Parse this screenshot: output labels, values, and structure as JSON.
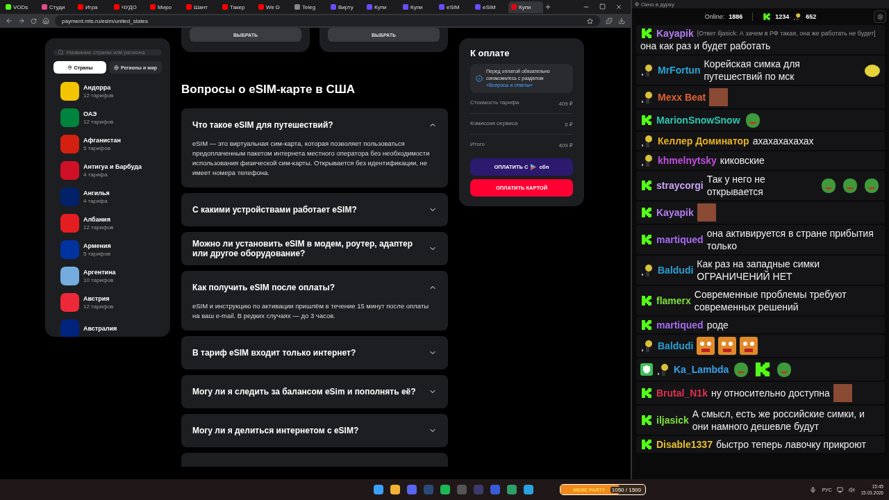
{
  "browser": {
    "tabs": [
      {
        "label": "VODs",
        "kind": "kick",
        "selected": false
      },
      {
        "label": "Студи",
        "kind": "studio",
        "selected": false
      },
      {
        "label": "Игра",
        "kind": "youtube",
        "selected": false
      },
      {
        "label": "ЧУДО",
        "kind": "youtube",
        "selected": false
      },
      {
        "label": "Миро",
        "kind": "youtube",
        "selected": false
      },
      {
        "label": "Шант",
        "kind": "youtube",
        "selected": false
      },
      {
        "label": "Такер",
        "kind": "youtube",
        "selected": false
      },
      {
        "label": "We D",
        "kind": "youtube",
        "selected": false
      },
      {
        "label": "Teleg",
        "kind": "globe",
        "selected": false
      },
      {
        "label": "Вирту",
        "kind": "purple",
        "selected": false
      },
      {
        "label": "Купи",
        "kind": "purple",
        "selected": false
      },
      {
        "label": "Купи",
        "kind": "purple",
        "selected": false
      },
      {
        "label": "eSIM",
        "kind": "purple",
        "selected": false
      },
      {
        "label": "eSIM",
        "kind": "purple",
        "selected": false
      },
      {
        "label": "Купи",
        "kind": "mts",
        "selected": true
      }
    ],
    "url": "payment.mts.ru/esim/united_states"
  },
  "sidebar": {
    "search_placeholder": "Название страны или региона",
    "tabs": [
      {
        "label": "Страны",
        "selected": true
      },
      {
        "label": "Регионы и мир",
        "selected": false
      }
    ],
    "countries": [
      {
        "name": "Андорра",
        "tariffs": "12 тарифов",
        "color": "#f2c500"
      },
      {
        "name": "ОАЭ",
        "tariffs": "12 тарифов",
        "color": "#00843d"
      },
      {
        "name": "Афганистан",
        "tariffs": "5 тарифов",
        "color": "#d32011"
      },
      {
        "name": "Антигуа и Барбуда",
        "tariffs": "4 тарифа",
        "color": "#ce1126"
      },
      {
        "name": "Ангилья",
        "tariffs": "4 тарифа",
        "color": "#012169"
      },
      {
        "name": "Албания",
        "tariffs": "12 тарифов",
        "color": "#e41e20"
      },
      {
        "name": "Армения",
        "tariffs": "5 тарифов",
        "color": "#0033a0"
      },
      {
        "name": "Аргентина",
        "tariffs": "10 тарифов",
        "color": "#74acdf"
      },
      {
        "name": "Австрия",
        "tariffs": "12 тарифов",
        "color": "#ed2939"
      },
      {
        "name": "Австралия",
        "color": "#00247d"
      }
    ]
  },
  "plans": [
    {
      "button": "ВЫБРАТЬ"
    },
    {
      "button": "ВЫБРАТЬ"
    }
  ],
  "faq": {
    "title": "Вопросы о eSIM-карте в США",
    "items": [
      {
        "question": "Что такое eSIM для путешествий?",
        "expanded": true,
        "answer": "eSIM — это виртуальная сим-карта, которая позволяет пользоваться предоплаченным пакетом интернета местного оператора без необходимости использования физической сим-карты. Открывается без идентификации, не имеет номера телефона."
      },
      {
        "question": "С какими устройствами работает eSIM?",
        "expanded": false
      },
      {
        "question": "Можно ли установить eSIM в модем, роутер, адаптер или другое оборудование?",
        "expanded": false
      },
      {
        "question": "Как получить eSIM после оплаты?",
        "expanded": true,
        "answer": "eSIM и инструкцию по активации пришлём в течение 15 минут после оплаты на ваш e-mail. В редких случаях — до 3 часов."
      },
      {
        "question": "В тариф eSIM входит только интернет?",
        "expanded": false
      },
      {
        "question": "Могу ли я следить за балансом eSim и пополнять её?",
        "expanded": false
      },
      {
        "question": "Могу ли я делиться интернетом с eSIM?",
        "expanded": false
      }
    ]
  },
  "payment": {
    "title": "К оплате",
    "notice": "Перед оплатой обязательно ознакомьтесь с разделом",
    "notice_link": "«Вопросы и ответы»",
    "rows": [
      {
        "label": "Стоимость тарифа",
        "value": "409 ₽"
      },
      {
        "label": "Комиссия сервиса",
        "value": "0 ₽"
      },
      {
        "label": "Итого",
        "value": "409 ₽"
      }
    ],
    "sbp_button": "ОПЛАТИТЬ С",
    "sbp_logo": "сбп",
    "card_button": "ОПЛАТИТЬ КАРТОЙ"
  },
  "chat": {
    "window_title": "Окно в дурку",
    "online_label": "Online:",
    "online": "1886",
    "kick_count": "1234",
    "bot_count": "652",
    "messages": [
      {
        "badges": [
          {
            "kind": "kick"
          }
        ],
        "user": "Kayapik",
        "color": "#b57cf0",
        "reply": "[Ответ iljasick: А зачем в РФ такая, она же работать не будет]",
        "text": "она как раз и будет работать"
      },
      {
        "badges": [
          {
            "kind": "bot"
          }
        ],
        "user": "MrFortun",
        "color": "#2aa6d8",
        "text": "Корейская симка для путешествий по мск",
        "emotes": [
          {
            "kind": "yellow"
          }
        ]
      },
      {
        "badges": [
          {
            "kind": "bot"
          }
        ],
        "user": "Mexx Beat",
        "color": "#e0612f",
        "emotes": [
          {
            "kind": "face"
          }
        ]
      },
      {
        "badges": [
          {
            "kind": "kick"
          }
        ],
        "user": "MarionSnowSnow",
        "color": "#2fc7b0",
        "emotes": [
          {
            "kind": "pepe"
          }
        ]
      },
      {
        "badges": [
          {
            "kind": "bot"
          }
        ],
        "user": "Келлер Доминатор",
        "color": "#e8b220",
        "text": "ахахахахахах"
      },
      {
        "badges": [
          {
            "kind": "bot"
          }
        ],
        "user": "khmelnytsky",
        "color": "#c24fe0",
        "text": "киковские"
      },
      {
        "badges": [
          {
            "kind": "kick"
          }
        ],
        "user": "straycorgi",
        "color": "#c9a4f5",
        "text": "Так у него не открывается",
        "emotes": [
          {
            "kind": "pepe"
          },
          {
            "kind": "pepe"
          },
          {
            "kind": "pepe"
          }
        ]
      },
      {
        "badges": [
          {
            "kind": "kick"
          }
        ],
        "user": "Kayapik",
        "color": "#b57cf0",
        "emotes": [
          {
            "kind": "face"
          }
        ]
      },
      {
        "badges": [
          {
            "kind": "kick"
          }
        ],
        "user": "martiqued",
        "color": "#a66cf0",
        "text": "она активируется в стране прибытия только"
      },
      {
        "badges": [
          {
            "kind": "bot"
          }
        ],
        "user": "Baldudi",
        "color": "#2a9fd0",
        "text": "Как раз на западные симки ОГРАНИЧЕНИЙ НЕТ"
      },
      {
        "badges": [
          {
            "kind": "kick"
          }
        ],
        "user": "flamerx",
        "color": "#7ee03a",
        "text": "Современные проблемы требуют современных решений"
      },
      {
        "badges": [
          {
            "kind": "kick"
          }
        ],
        "user": "martiqued",
        "color": "#a66cf0",
        "text": "роде"
      },
      {
        "badges": [
          {
            "kind": "bot"
          }
        ],
        "user": "Baldudi",
        "color": "#2a9fd0",
        "emotes": [
          {
            "kind": "tiger"
          },
          {
            "kind": "tiger"
          },
          {
            "kind": "tiger"
          }
        ]
      },
      {
        "badges": [
          {
            "kind": "shield"
          },
          {
            "kind": "bot"
          }
        ],
        "user": "Ka_Lambda",
        "color": "#3aa0e8",
        "emotes": [
          {
            "kind": "pepe"
          },
          {
            "kind": "kick"
          },
          {
            "kind": "pepe"
          }
        ]
      },
      {
        "badges": [
          {
            "kind": "kick"
          }
        ],
        "user": "Brutal_N1k",
        "color": "#e03050",
        "text": "ну относительно доступна",
        "emotes": [
          {
            "kind": "face"
          }
        ]
      },
      {
        "badges": [
          {
            "kind": "kick"
          }
        ],
        "user": "iljasick",
        "color": "#7ee03a",
        "text": "А смысл, есть же российские симки, и они намного дешевле будут"
      },
      {
        "badges": [
          {
            "kind": "kick"
          }
        ],
        "user": "Disable1337",
        "color": "#e8c030",
        "text": "быстро теперь лавочку прикроют"
      }
    ]
  },
  "taskbar": {
    "apps": [
      {
        "kind": "windows"
      },
      {
        "kind": "chrome"
      },
      {
        "kind": "discord"
      },
      {
        "kind": "steam"
      },
      {
        "kind": "spotify"
      },
      {
        "kind": "obs"
      },
      {
        "kind": "app"
      },
      {
        "kind": "video"
      },
      {
        "kind": "snip"
      },
      {
        "kind": "telegram"
      }
    ],
    "widget_title": "MEME PARTY",
    "widget_progress": "1050 / 1500",
    "level": 0.7,
    "language": "РУС",
    "time": "15:45",
    "date": "15.03.2026"
  }
}
